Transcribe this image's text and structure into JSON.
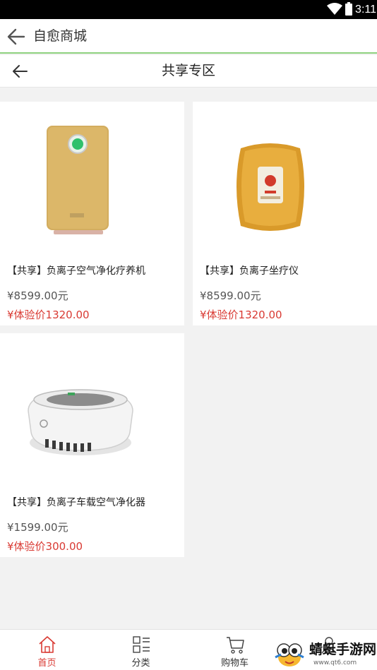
{
  "status_bar": {
    "time": "3:11"
  },
  "app_bar": {
    "title": "自愈商城"
  },
  "sub_bar": {
    "title": "共享专区"
  },
  "products": [
    {
      "name": "【共享】负离子空气净化疗养机",
      "price": "¥8599.00元",
      "trial_price": "¥体验价1320.00",
      "image": "air-purifier-tower"
    },
    {
      "name": "【共享】负离子坐疗仪",
      "price": "¥8599.00元",
      "trial_price": "¥体验价1320.00",
      "image": "seat-therapy-device"
    },
    {
      "name": "【共享】负离子车载空气净化器",
      "price": "¥1599.00元",
      "trial_price": "¥体验价300.00",
      "image": "car-air-purifier"
    }
  ],
  "tabs": [
    {
      "label": "首页",
      "icon": "home-icon",
      "active": true
    },
    {
      "label": "分类",
      "icon": "category-grid-icon",
      "active": false
    },
    {
      "label": "购物车",
      "icon": "cart-icon",
      "active": false
    },
    {
      "label": "",
      "icon": "user-icon",
      "active": false
    }
  ],
  "watermark": {
    "title": "蜻蜓手游网",
    "url": "www.qt6.com"
  },
  "colors": {
    "accent_red": "#d93a33",
    "divider_green": "#8fd17f",
    "background": "#f2f2f2"
  }
}
